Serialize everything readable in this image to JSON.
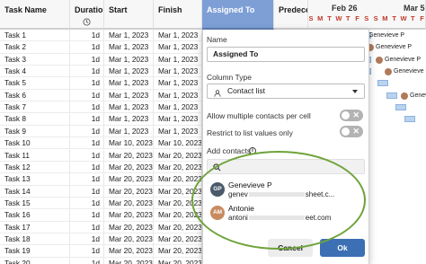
{
  "columns": {
    "task_name": "Task Name",
    "duration": "Duration",
    "start": "Start",
    "finish": "Finish",
    "assigned_to": "Assigned To",
    "predecessors": "Predece"
  },
  "gantt": {
    "month_feb": "Feb 26",
    "month_mar": "Mar 5",
    "days": [
      "S",
      "M",
      "T",
      "W",
      "T",
      "F",
      "S",
      "S",
      "M",
      "T",
      "W",
      "T",
      "F"
    ],
    "names": [
      "Genevieve P",
      "Genevieve P",
      "Genevieve P",
      "Genevieve P",
      "Genevieve P",
      "Genevieve P",
      "Genevi"
    ]
  },
  "rows": [
    {
      "task": "Task 1",
      "duration": "1d",
      "start": "Mar 1, 2023",
      "finish": "Mar 1, 2023"
    },
    {
      "task": "Task 2",
      "duration": "1d",
      "start": "Mar 1, 2023",
      "finish": "Mar 1, 2023"
    },
    {
      "task": "Task 3",
      "duration": "1d",
      "start": "Mar 1, 2023",
      "finish": "Mar 1, 2023"
    },
    {
      "task": "Task 4",
      "duration": "1d",
      "start": "Mar 1, 2023",
      "finish": "Mar 1, 2023"
    },
    {
      "task": "Task 5",
      "duration": "1d",
      "start": "Mar 1, 2023",
      "finish": "Mar 1, 2023"
    },
    {
      "task": "Task 6",
      "duration": "1d",
      "start": "Mar 1, 2023",
      "finish": "Mar 1, 2023"
    },
    {
      "task": "Task 7",
      "duration": "1d",
      "start": "Mar 1, 2023",
      "finish": "Mar 1, 2023"
    },
    {
      "task": "Task 8",
      "duration": "1d",
      "start": "Mar 1, 2023",
      "finish": "Mar 1, 2023"
    },
    {
      "task": "Task 9",
      "duration": "1d",
      "start": "Mar 1, 2023",
      "finish": "Mar 1, 2023"
    },
    {
      "task": "Task 10",
      "duration": "1d",
      "start": "Mar 10, 2023",
      "finish": "Mar 10, 2023"
    },
    {
      "task": "Task 11",
      "duration": "1d",
      "start": "Mar 20, 2023",
      "finish": "Mar 20, 2023"
    },
    {
      "task": "Task 12",
      "duration": "1d",
      "start": "Mar 20, 2023",
      "finish": "Mar 20, 2023"
    },
    {
      "task": "Task 13",
      "duration": "1d",
      "start": "Mar 20, 2023",
      "finish": "Mar 20, 2023"
    },
    {
      "task": "Task 14",
      "duration": "1d",
      "start": "Mar 20, 2023",
      "finish": "Mar 20, 2023"
    },
    {
      "task": "Task 15",
      "duration": "1d",
      "start": "Mar 20, 2023",
      "finish": "Mar 20, 2023"
    },
    {
      "task": "Task 16",
      "duration": "1d",
      "start": "Mar 20, 2023",
      "finish": "Mar 20, 2023"
    },
    {
      "task": "Task 17",
      "duration": "1d",
      "start": "Mar 20, 2023",
      "finish": "Mar 20, 2023"
    },
    {
      "task": "Task 18",
      "duration": "1d",
      "start": "Mar 20, 2023",
      "finish": "Mar 20, 2023"
    },
    {
      "task": "Task 19",
      "duration": "1d",
      "start": "Mar 20, 2023",
      "finish": "Mar 20, 2023"
    },
    {
      "task": "Task 20",
      "duration": "1d",
      "start": "Mar 20, 2023",
      "finish": "Mar 20, 2023"
    }
  ],
  "panel": {
    "name_label": "Name",
    "name_value": "Assigned To",
    "column_type_label": "Column Type",
    "column_type_value": "Contact list",
    "allow_multiple_label": "Allow multiple contacts per cell",
    "restrict_label": "Restrict to list values only",
    "add_contacts_label": "Add contacts",
    "search_placeholder": "",
    "contacts": [
      {
        "initials": "GP",
        "name": "Genevieve P",
        "email_start": "genev",
        "email_end": "sheet.c...",
        "color": "#4a5a6a"
      },
      {
        "initials": "AM",
        "name": "Antonie",
        "email_start": "antoni",
        "email_end": "eet.com",
        "color": "#c98a5f"
      }
    ],
    "cancel_label": "Cancel",
    "ok_label": "Ok"
  },
  "colors": {
    "accent": "#3c6fb4",
    "header_selected": "#7d9fd6",
    "highlight_ellipse": "#6fa33b",
    "weekend_day": "#c0392b"
  }
}
